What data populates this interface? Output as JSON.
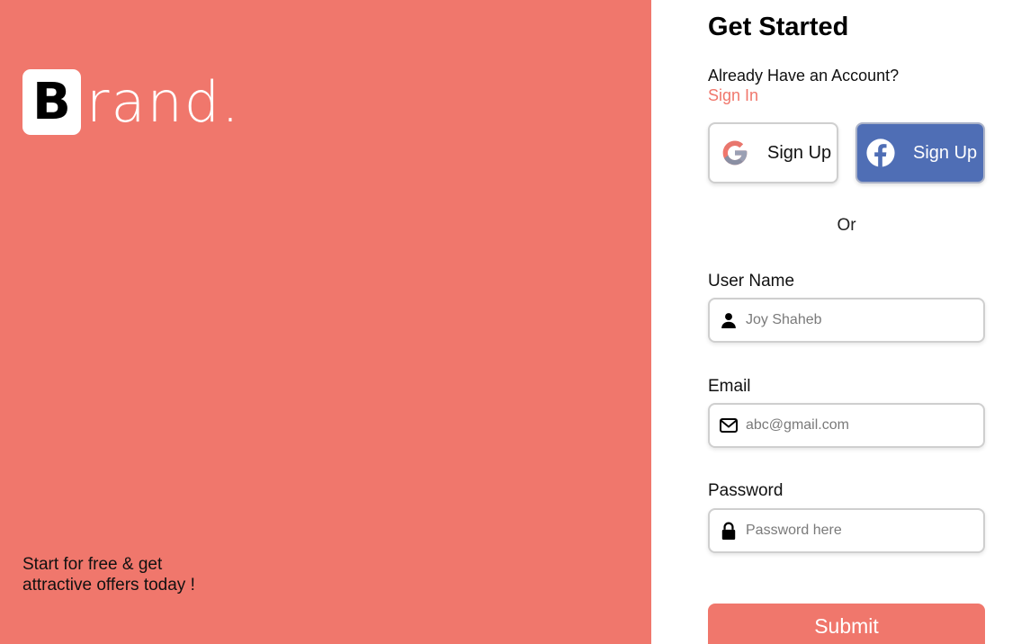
{
  "brand": {
    "logo_letter": "B",
    "logo_rest": "rand.",
    "tagline_line1": "Start for free & get",
    "tagline_line2": "attractive offers today !",
    "panel_color": "#f0776c"
  },
  "form": {
    "title": "Get Started",
    "account_question": "Already Have an Account?",
    "signin_label": "Sign In",
    "social": {
      "google": {
        "icon": "google-icon",
        "label": "Sign Up"
      },
      "facebook": {
        "icon": "facebook-icon",
        "label": "Sign Up",
        "color": "#4f6eb5"
      }
    },
    "divider": "Or",
    "fields": {
      "username": {
        "label": "User Name",
        "placeholder": "Joy Shaheb",
        "icon": "user-icon"
      },
      "email": {
        "label": "Email",
        "placeholder": "abc@gmail.com",
        "icon": "envelope-icon"
      },
      "password": {
        "label": "Password",
        "placeholder": "Password here",
        "icon": "lock-icon"
      }
    },
    "submit_label": "Submit"
  }
}
